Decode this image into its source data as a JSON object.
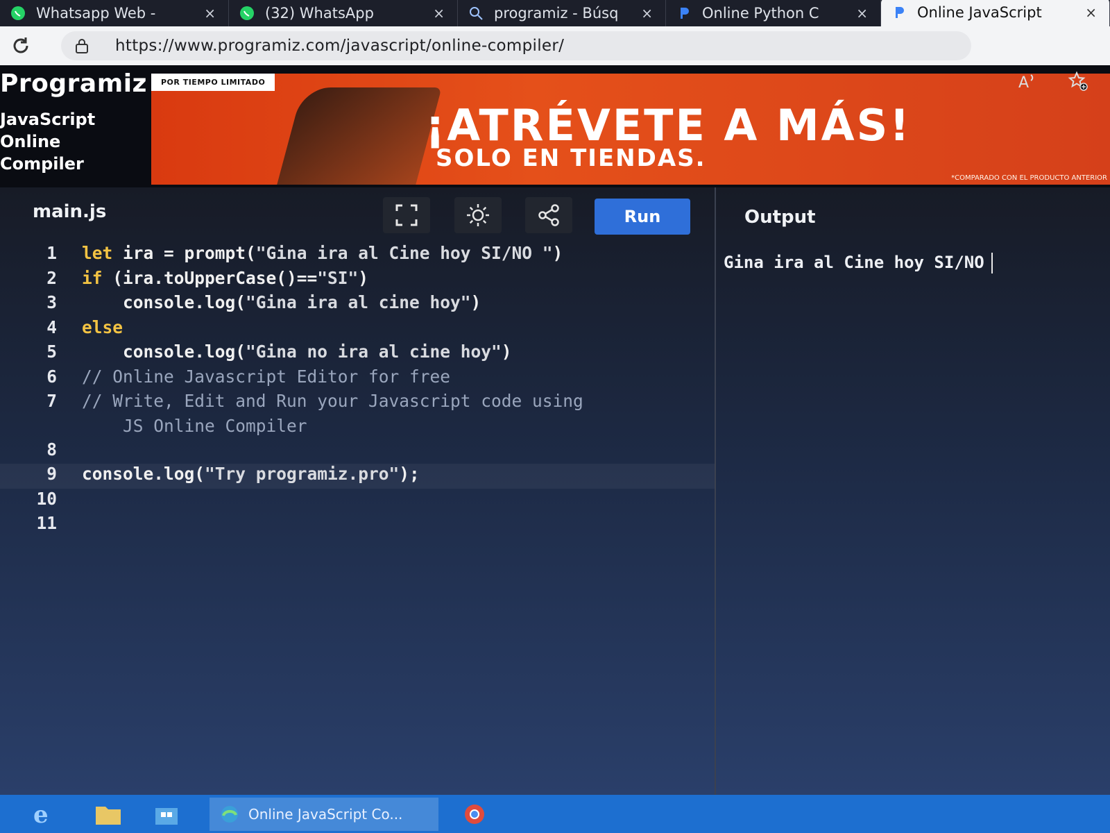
{
  "tabs": [
    {
      "title": "Whatsapp Web -",
      "icon": "whatsapp-icon"
    },
    {
      "title": "(32) WhatsApp",
      "icon": "whatsapp-icon"
    },
    {
      "title": "programiz - Búsq",
      "icon": "search-icon"
    },
    {
      "title": "Online Python C",
      "icon": "programiz-icon"
    },
    {
      "title": "Online JavaScript",
      "icon": "programiz-icon",
      "active": true
    }
  ],
  "tab_close": "×",
  "address": {
    "url": "https://www.programiz.com/javascript/online-compiler/"
  },
  "site": {
    "brand": "Programiz",
    "subtitle": [
      "JavaScript",
      "Online",
      "Compiler"
    ]
  },
  "banner": {
    "tag": "POR TIEMPO LIMITADO",
    "headline": "¡ATRÉVETE A MÁS!",
    "subline": "SOLO EN TIENDAS.",
    "fineprint": "*COMPARADO CON EL PRODUCTO ANTERIOR",
    "color": "#e5501a"
  },
  "editor": {
    "file_name": "main.js",
    "run_label": "Run",
    "accent": "#2f6fd9",
    "lines": [
      {
        "num": "1",
        "parts": [
          {
            "c": "kw",
            "t": "let "
          },
          {
            "c": "fn",
            "t": "ira = prompt("
          },
          {
            "c": "str",
            "t": "\"Gina ira al Cine hoy SI/NO \""
          },
          {
            "c": "fn",
            "t": ")"
          }
        ]
      },
      {
        "num": "2",
        "parts": [
          {
            "c": "kw",
            "t": "if "
          },
          {
            "c": "fn",
            "t": "(ira.toUpperCase()=="
          },
          {
            "c": "str",
            "t": "\"SI\""
          },
          {
            "c": "fn",
            "t": ")"
          }
        ]
      },
      {
        "num": "3",
        "parts": [
          {
            "c": "fn",
            "t": "    console.log("
          },
          {
            "c": "str",
            "t": "\"Gina ira al cine hoy\""
          },
          {
            "c": "fn",
            "t": ")"
          }
        ]
      },
      {
        "num": "4",
        "parts": [
          {
            "c": "kw",
            "t": "else"
          }
        ]
      },
      {
        "num": "5",
        "parts": [
          {
            "c": "fn",
            "t": "    console.log("
          },
          {
            "c": "str",
            "t": "\"Gina no ira al cine hoy\""
          },
          {
            "c": "fn",
            "t": ")"
          }
        ]
      },
      {
        "num": "6",
        "parts": [
          {
            "c": "cm",
            "t": "// Online Javascript Editor for free"
          }
        ]
      },
      {
        "num": "7",
        "parts": [
          {
            "c": "cm",
            "t": "// Write, Edit and Run your Javascript code using"
          }
        ]
      },
      {
        "num": "",
        "parts": [
          {
            "c": "cm",
            "t": "    JS Online Compiler"
          }
        ],
        "cont": true
      },
      {
        "num": "8",
        "parts": []
      },
      {
        "num": "9",
        "parts": [
          {
            "c": "fn",
            "t": "console.log("
          },
          {
            "c": "str",
            "t": "\"Try programiz.pro\""
          },
          {
            "c": "fn",
            "t": ");"
          }
        ],
        "active": true
      },
      {
        "num": "10",
        "parts": []
      },
      {
        "num": "11",
        "parts": []
      }
    ]
  },
  "output": {
    "title": "Output",
    "text": "Gina ira al Cine hoy SI/NO"
  },
  "taskbar": {
    "app_label": "Online JavaScript Co..."
  }
}
